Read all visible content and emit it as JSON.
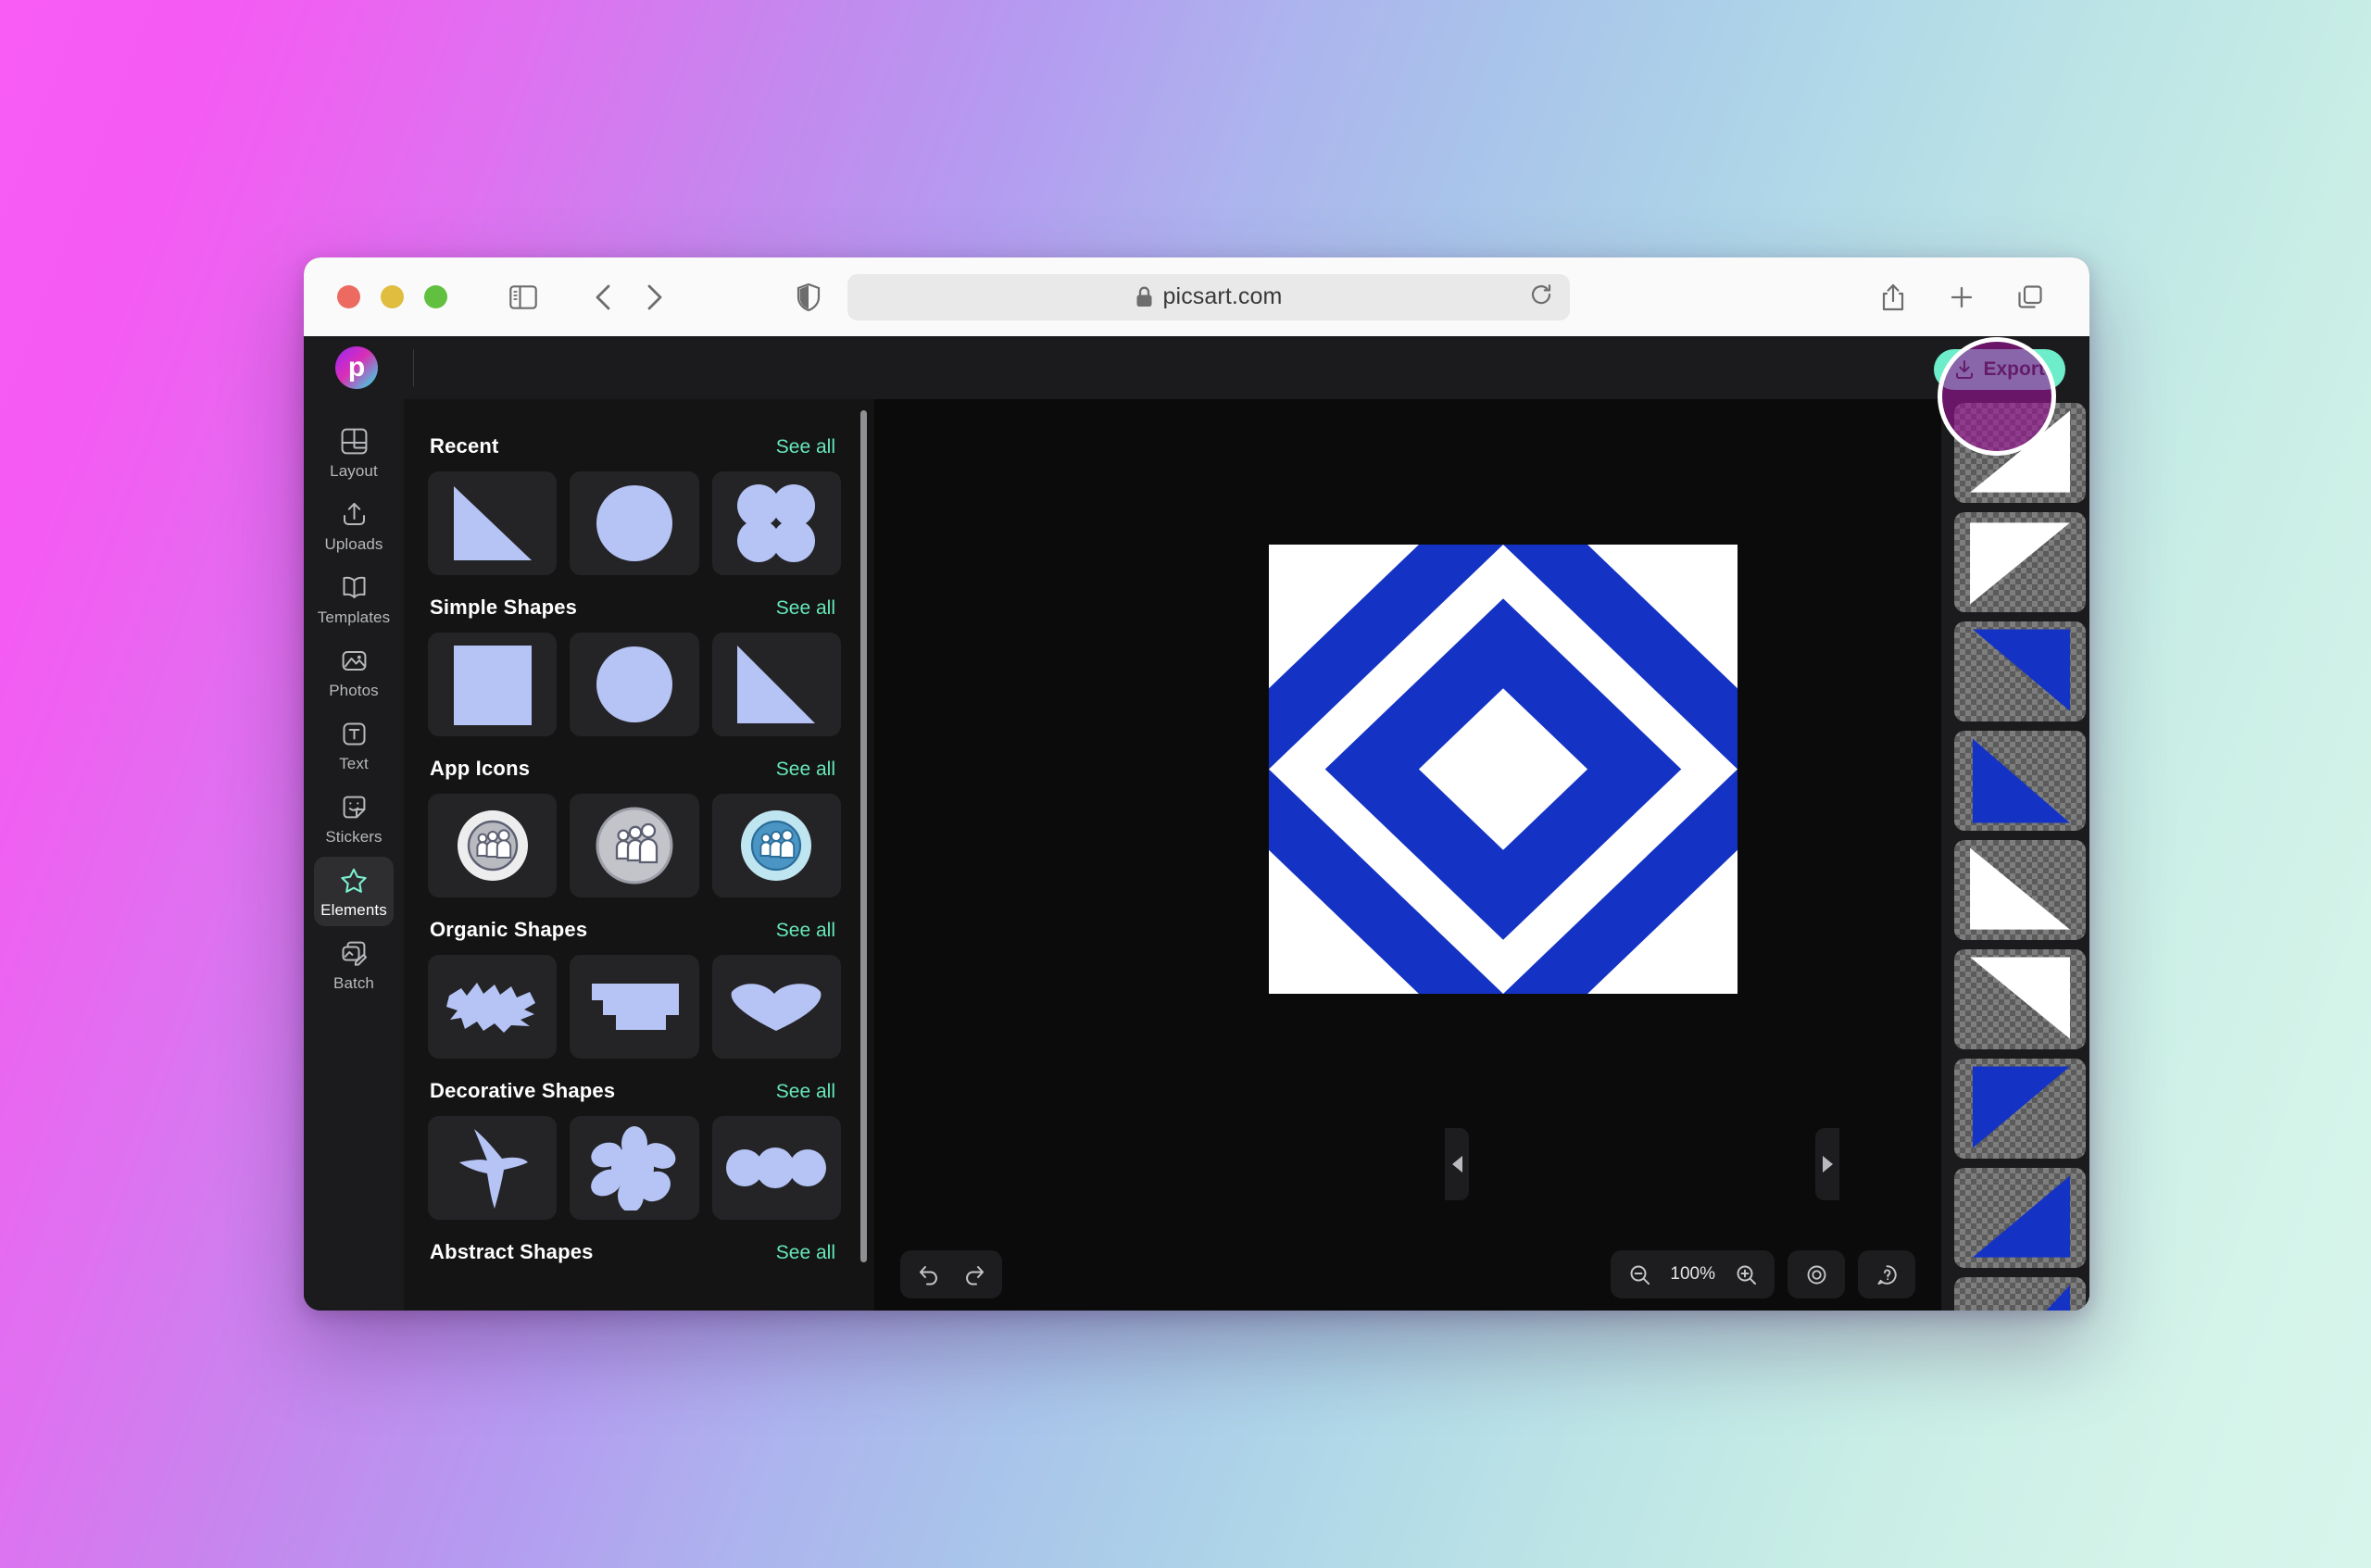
{
  "browser": {
    "url": "picsart.com",
    "lock_icon": "lock-icon",
    "traffic_lights": [
      "close-red",
      "minimize-yellow",
      "maximize-green"
    ],
    "sidebar_toggle_icon": "sidebar-toggle-icon",
    "back_icon": "chevron-left-icon",
    "forward_icon": "chevron-right-icon",
    "shield_icon": "shield-privacy-icon",
    "reload_icon": "reload-icon",
    "share_icon": "share-icon",
    "new_tab_icon": "plus-icon",
    "tabs_overview_icon": "tabs-overview-icon"
  },
  "app": {
    "logo_letter": "p",
    "export_label": "Export",
    "export_icon": "download-icon",
    "export_bg": "#6dedc9"
  },
  "sidebar": {
    "items": [
      {
        "label": "Layout",
        "icon": "layout-icon",
        "active": false
      },
      {
        "label": "Uploads",
        "icon": "upload-icon",
        "active": false
      },
      {
        "label": "Templates",
        "icon": "templates-icon",
        "active": false
      },
      {
        "label": "Photos",
        "icon": "photos-icon",
        "active": false
      },
      {
        "label": "Text",
        "icon": "text-icon",
        "active": false
      },
      {
        "label": "Stickers",
        "icon": "stickers-icon",
        "active": false
      },
      {
        "label": "Elements",
        "icon": "star-icon",
        "active": true
      },
      {
        "label": "Batch",
        "icon": "batch-icon",
        "active": false
      }
    ],
    "active_accent": "#7df2d0"
  },
  "panel": {
    "see_all_label": "See all",
    "see_all_color": "#66e8b8",
    "shape_fill": "#b5c4f5",
    "sections": [
      {
        "title": "Recent",
        "items": [
          "triangle",
          "circle",
          "clover"
        ]
      },
      {
        "title": "Simple Shapes",
        "items": [
          "square",
          "circle",
          "triangle"
        ]
      },
      {
        "title": "App Icons",
        "items": [
          "people-light",
          "people-gray",
          "people-blue"
        ]
      },
      {
        "title": "Organic Shapes",
        "items": [
          "scribble-blob",
          "stepped-block",
          "heart-blob"
        ]
      },
      {
        "title": "Decorative Shapes",
        "items": [
          "bird",
          "flower",
          "three-blobs"
        ]
      },
      {
        "title": "Abstract Shapes",
        "items": []
      }
    ]
  },
  "canvas": {
    "art_title": "blue-white-diagonal-quilt-pattern",
    "blue": "#1433C4",
    "white": "#FFFFFF"
  },
  "toolbar": {
    "undo_icon": "undo-icon",
    "redo_icon": "redo-icon",
    "zoom_out_icon": "zoom-out-icon",
    "zoom_in_icon": "zoom-in-icon",
    "zoom_level": "100%",
    "preview_icon": "eye-icon",
    "help_icon": "help-icon"
  },
  "layers": {
    "items": [
      {
        "shape": "tri-tr-white"
      },
      {
        "shape": "tri-tl-white"
      },
      {
        "shape": "tri-tr-blue-fill"
      },
      {
        "shape": "tri-tl-blue"
      },
      {
        "shape": "tri-tl-white-2"
      },
      {
        "shape": "tri-tr-white-2"
      },
      {
        "shape": "tri-tl-blue-2"
      },
      {
        "shape": "tri-tr-blue-2"
      },
      {
        "shape": "tri-tr-blue-3"
      }
    ]
  },
  "collapse": {
    "left_handle_icon": "caret-left-icon",
    "right_handle_icon": "caret-right-icon"
  }
}
